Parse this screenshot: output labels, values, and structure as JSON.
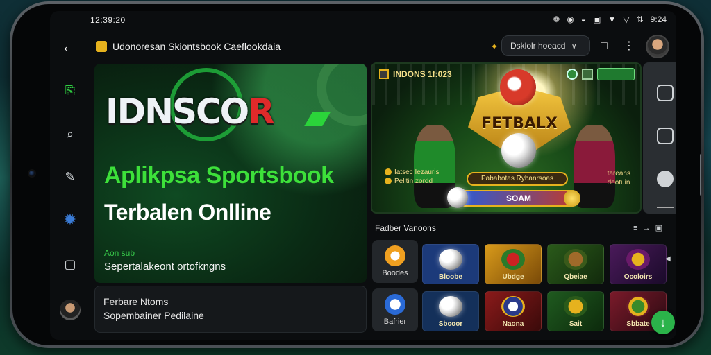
{
  "status_bar": {
    "time": "12:39:20",
    "right_time": "9:24"
  },
  "app_bar": {
    "back_icon": "arrow-left-icon",
    "title": "Udonoresan Skiontsbook Caeflookdaia",
    "chip_label": "Dsklolr hoeacd",
    "chip_icon": "chevron-down-icon"
  },
  "left_rail": {
    "items": [
      {
        "icon": "cast-icon"
      },
      {
        "icon": "search-icon"
      },
      {
        "icon": "pencil-icon"
      },
      {
        "icon": "puzzle-icon"
      },
      {
        "icon": "window-icon"
      }
    ]
  },
  "hero": {
    "brand_main": "IDNSCO",
    "brand_red": "R",
    "headline_1": "Aplikpsa Sportsbook",
    "headline_2": "Terbalen Onlline",
    "small_label": "Aon sub",
    "subtext": "Sepertalakeont ortofkngns"
  },
  "promo_card": {
    "line_1": "Ferbare Ntoms",
    "line_2": "Sopembainer Pedilaine"
  },
  "banner": {
    "top_label": "INDONS 1f:023",
    "shield_text": "FETBALX",
    "left_text_1": "Iatsec Iezauris",
    "left_text_2": "Pelltin zordd",
    "mid_text": "Pababotas Rybanrsoas",
    "right_text_1": "tareans",
    "right_text_2": "deotuin",
    "cta_label": "SOAM"
  },
  "games": {
    "heading": "Fadber Vanoons",
    "heading_icons": "≡ → ▣",
    "categories": [
      {
        "label": "Boodes"
      },
      {
        "label": "Bafrier"
      }
    ],
    "row_1": [
      {
        "label": "Bloobe",
        "bg": "#1c3a7a"
      },
      {
        "label": "Ubdge",
        "bg": "#b07a12"
      },
      {
        "label": "Qbeiae",
        "bg": "#1f4a1f"
      },
      {
        "label": "Ocoloirs",
        "bg": "#3a1a4a"
      }
    ],
    "row_2": [
      {
        "label": "Sbcoor",
        "bg": "#14305a"
      },
      {
        "label": "Naona",
        "bg": "#6a1a1a"
      },
      {
        "label": "Sait",
        "bg": "#1f4a1f"
      },
      {
        "label": "Sbbate",
        "bg": "#6a1a2a"
      }
    ]
  },
  "colors": {
    "accent_green": "#3de03a",
    "gold": "#e6b21e",
    "fab_green": "#2bb34a"
  }
}
